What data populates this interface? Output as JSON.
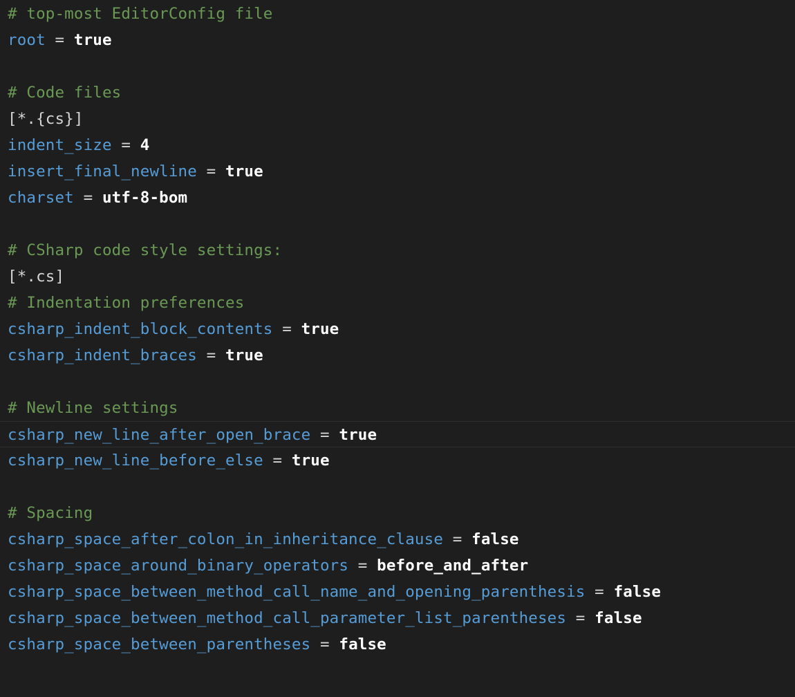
{
  "lines": [
    {
      "type": "comment",
      "text": "# top-most EditorConfig file"
    },
    {
      "type": "pair",
      "key": "root",
      "value": "true"
    },
    {
      "type": "blank"
    },
    {
      "type": "comment",
      "text": "# Code files"
    },
    {
      "type": "section",
      "text": "[*.{cs}]"
    },
    {
      "type": "pair",
      "key": "indent_size",
      "value": "4"
    },
    {
      "type": "pair",
      "key": "insert_final_newline",
      "value": "true"
    },
    {
      "type": "pair",
      "key": "charset",
      "value": "utf-8-bom"
    },
    {
      "type": "blank"
    },
    {
      "type": "comment",
      "text": "# CSharp code style settings:"
    },
    {
      "type": "section",
      "text": "[*.cs]"
    },
    {
      "type": "comment",
      "text": "# Indentation preferences"
    },
    {
      "type": "pair",
      "key": "csharp_indent_block_contents",
      "value": "true"
    },
    {
      "type": "pair",
      "key": "csharp_indent_braces",
      "value": "true"
    },
    {
      "type": "blank"
    },
    {
      "type": "comment",
      "text": "# Newline settings"
    },
    {
      "type": "pair",
      "key": "csharp_new_line_after_open_brace",
      "value": "true",
      "current": true
    },
    {
      "type": "pair",
      "key": "csharp_new_line_before_else",
      "value": "true"
    },
    {
      "type": "blank"
    },
    {
      "type": "comment",
      "text": "# Spacing"
    },
    {
      "type": "pair",
      "key": "csharp_space_after_colon_in_inheritance_clause",
      "value": "false"
    },
    {
      "type": "pair",
      "key": "csharp_space_around_binary_operators",
      "value": "before_and_after"
    },
    {
      "type": "pair",
      "key": "csharp_space_between_method_call_name_and_opening_parenthesis",
      "value": "false"
    },
    {
      "type": "pair",
      "key": "csharp_space_between_method_call_parameter_list_parentheses",
      "value": "false"
    },
    {
      "type": "pair",
      "key": "csharp_space_between_parentheses",
      "value": "false"
    }
  ],
  "operator": " = ",
  "colors": {
    "background": "#1e1e1e",
    "comment": "#6a9955",
    "key": "#569cd6",
    "value": "#ffffff",
    "plain": "#d4d4d4",
    "current_line_border": "#2f2f2f"
  }
}
